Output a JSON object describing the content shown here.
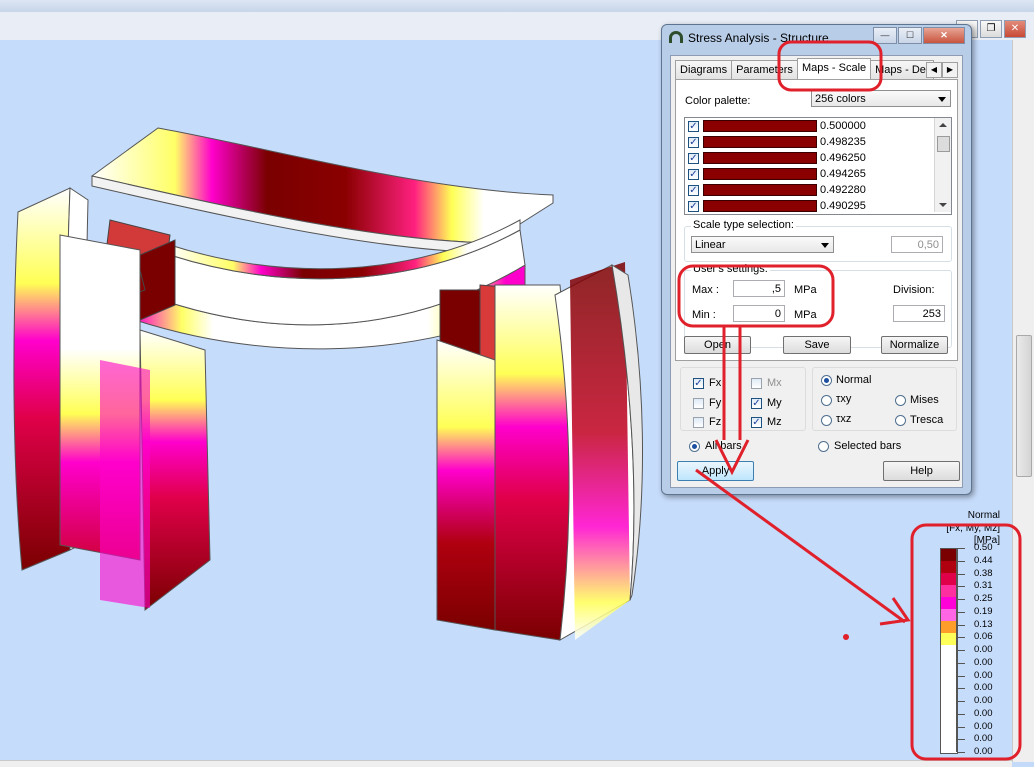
{
  "dialog": {
    "title": "Stress Analysis - Structure",
    "tabs": [
      "Diagrams",
      "Parameters",
      "Maps - Scale",
      "Maps - Def"
    ],
    "color_palette_label": "Color palette:",
    "color_palette_value": "256 colors",
    "palette_values": [
      "0.500000",
      "0.498235",
      "0.496250",
      "0.494265",
      "0.492280",
      "0.490295"
    ],
    "scale_type_title": "Scale type selection:",
    "scale_type_value": "Linear",
    "scale_factor": "0,50",
    "user_settings_title": "User's settings:",
    "max_label": "Max :",
    "max_value": ",5",
    "min_label": "Min :",
    "min_value": "0",
    "unit": "MPa",
    "division_label": "Division:",
    "division_value": "253",
    "open_label": "Open",
    "save_label": "Save",
    "normalize_label": "Normalize",
    "fx_label": "Fx",
    "fy_label": "Fy",
    "fz_label": "Fz",
    "mx_label": "Mx",
    "my_label": "My",
    "mz_label": "Mz",
    "normal_label": "Normal",
    "txy_label": "τxy",
    "txz_label": "τxz",
    "mises_label": "Mises",
    "tresca_label": "Tresca",
    "all_bars_label": "All bars",
    "selected_bars_label": "Selected bars",
    "apply_label": "Apply",
    "help_label": "Help"
  },
  "legend": {
    "title": "Normal",
    "subtitle": "[Fx, My, Mz]",
    "unit": "[MPa]",
    "values": [
      "0.50",
      "0.44",
      "0.38",
      "0.31",
      "0.25",
      "0.19",
      "0.13",
      "0.06",
      "0.00",
      "0.00",
      "0.00",
      "0.00",
      "0.00",
      "0.00",
      "0.00",
      "0.00",
      "0.00"
    ],
    "colors": [
      "#7a0000",
      "#b00010",
      "#e0004a",
      "#ff2fa0",
      "#ff00d8",
      "#ff66e6",
      "#ff9d2a",
      "#ffff5a",
      "#ffffff"
    ]
  },
  "colors": {
    "annotation": "#e0202a",
    "stress_max": "#7a0000",
    "viewport_bg": "#c6dcfb"
  }
}
